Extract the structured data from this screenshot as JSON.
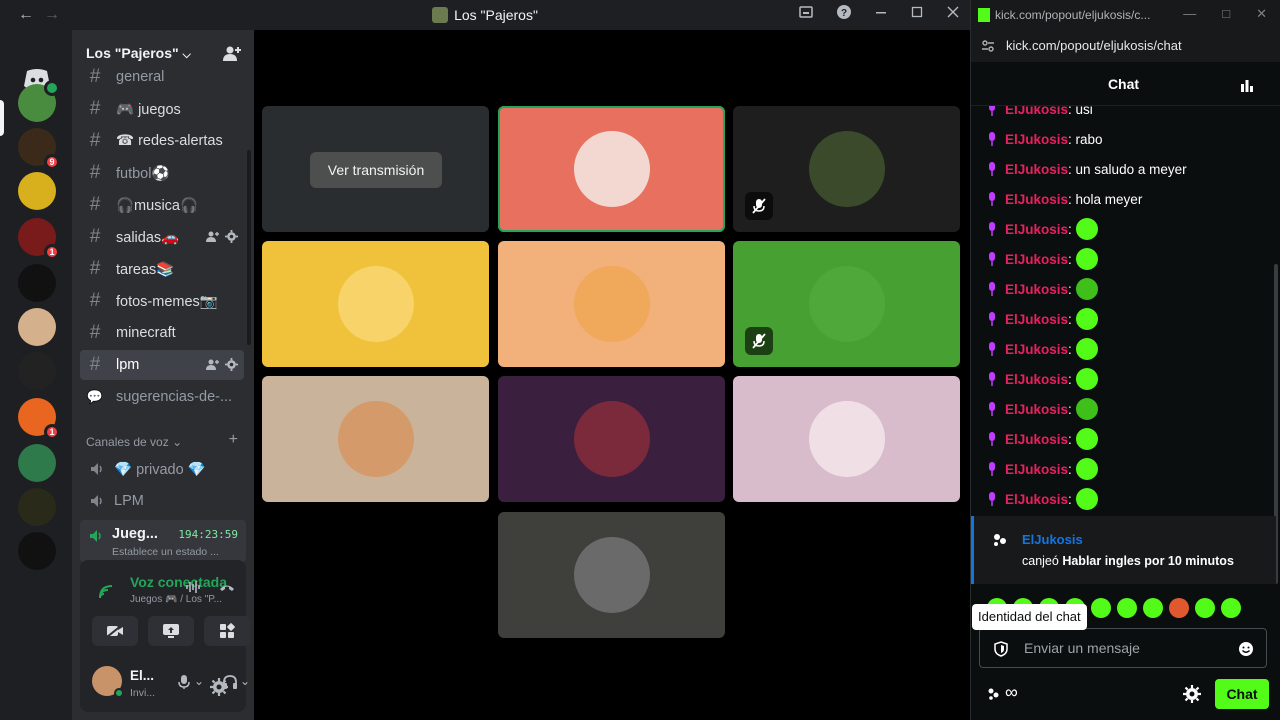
{
  "titlebar": {
    "title": "Los \"Pajeros\"",
    "back": "←",
    "forward": "→"
  },
  "guilds": [
    {
      "icon": "discord-home-icon"
    },
    {
      "badge": "",
      "speaking": true,
      "color": "#4a8c3f"
    },
    {
      "badge": "9",
      "color": "#3b2a1a"
    },
    {
      "badge": "",
      "color": "#d8b01e"
    },
    {
      "badge": "1",
      "color": "#7a1b1b"
    },
    {
      "badge": "",
      "color": "#111111"
    },
    {
      "badge": "",
      "color": "#d4b08c"
    },
    {
      "badge": "",
      "color": "#222222"
    },
    {
      "badge": "1",
      "color": "#e8661f"
    },
    {
      "badge": "",
      "color": "#2e7a4a"
    },
    {
      "badge": "",
      "color": "#2a2a1a"
    },
    {
      "badge": "",
      "color": "#111111"
    }
  ],
  "server": {
    "name": "Los \"Pajeros\""
  },
  "text_channels": [
    {
      "name": "general",
      "muted": true
    },
    {
      "name": "🎮 juegos",
      "muted": false
    },
    {
      "name": "☎ redes-alertas",
      "muted": false
    },
    {
      "name": "futbol⚽",
      "muted": true
    },
    {
      "name": "🎧musica🎧",
      "muted": false
    },
    {
      "name": "salidas🚗",
      "muted": false
    },
    {
      "name": "tareas📚",
      "muted": false
    },
    {
      "name": "fotos-memes📷",
      "muted": false
    },
    {
      "name": "minecraft",
      "muted": false
    },
    {
      "name": "lpm",
      "muted": false,
      "active": true
    },
    {
      "name": "sugerencias-de-...",
      "muted": true
    }
  ],
  "voice": {
    "category": "Canales de voz",
    "channels": [
      {
        "name": "💎 privado 💎"
      },
      {
        "name": "LPM"
      }
    ],
    "active": {
      "name": "Jueg...",
      "time": "194:23:59",
      "status": "Establece un estado ..."
    }
  },
  "panel": {
    "connected": "Voz conectada",
    "location": "Juegos 🎮 / Los \"P...",
    "user_name": "El...",
    "user_status": "Invi..."
  },
  "stage": {
    "watch_button": "Ver transmisión",
    "tiles": [
      {
        "bg": "#2a2d2f",
        "avatar": "",
        "stream": true
      },
      {
        "bg": "#e8705f",
        "avatar": "#f2d8d0",
        "speaking": true
      },
      {
        "bg": "#1e1e1e",
        "avatar": "#3a4a2a",
        "muted": true
      },
      {
        "bg": "#f0c23b",
        "avatar": "#f7d36a"
      },
      {
        "bg": "#f2b07a",
        "avatar": "#f0a85a"
      },
      {
        "bg": "#46a032",
        "avatar": "#4ea83a",
        "deaf": true
      },
      {
        "bg": "#c9b39a",
        "avatar": "#d49a6a"
      },
      {
        "bg": "#3b1f3f",
        "avatar": "#7a2a3a"
      },
      {
        "bg": "#d8bccc",
        "avatar": "#f0e0e6"
      },
      {
        "bg": "#3f3f3c",
        "avatar": "#6a6a6a"
      }
    ]
  },
  "kick": {
    "window_title": "kick.com/popout/eljukosis/c...",
    "url": "kick.com/popout/eljukosis/chat",
    "header": "Chat",
    "messages": [
      {
        "user": "ElJukosis",
        "text": ": usi"
      },
      {
        "user": "ElJukosis",
        "text": ": rabo"
      },
      {
        "user": "ElJukosis",
        "text": ": un saludo a meyer"
      },
      {
        "user": "ElJukosis",
        "text": ": hola meyer"
      },
      {
        "user": "ElJukosis",
        "text": ":",
        "emote": true
      },
      {
        "user": "ElJukosis",
        "text": ":",
        "emote": true
      },
      {
        "user": "ElJukosis",
        "text": ":",
        "emote": true
      },
      {
        "user": "ElJukosis",
        "text": ":",
        "emote": true
      },
      {
        "user": "ElJukosis",
        "text": ":",
        "emote": true
      },
      {
        "user": "ElJukosis",
        "text": ":",
        "emote": true
      },
      {
        "user": "ElJukosis",
        "text": ":",
        "emote": true
      },
      {
        "user": "ElJukosis",
        "text": ":",
        "emote": true
      },
      {
        "user": "ElJukosis",
        "text": ":",
        "emote": true
      },
      {
        "user": "ElJukosis",
        "text": ":",
        "emote": true
      }
    ],
    "redeem": {
      "user": "ElJukosis",
      "prefix": "canjeó",
      "reward": "Hablar ingles por 10 minutos"
    },
    "tooltip": "Identidad del chat",
    "input_placeholder": "Enviar un mensaje",
    "points": "∞",
    "chat_button": "Chat",
    "accent": "#53fc18"
  }
}
